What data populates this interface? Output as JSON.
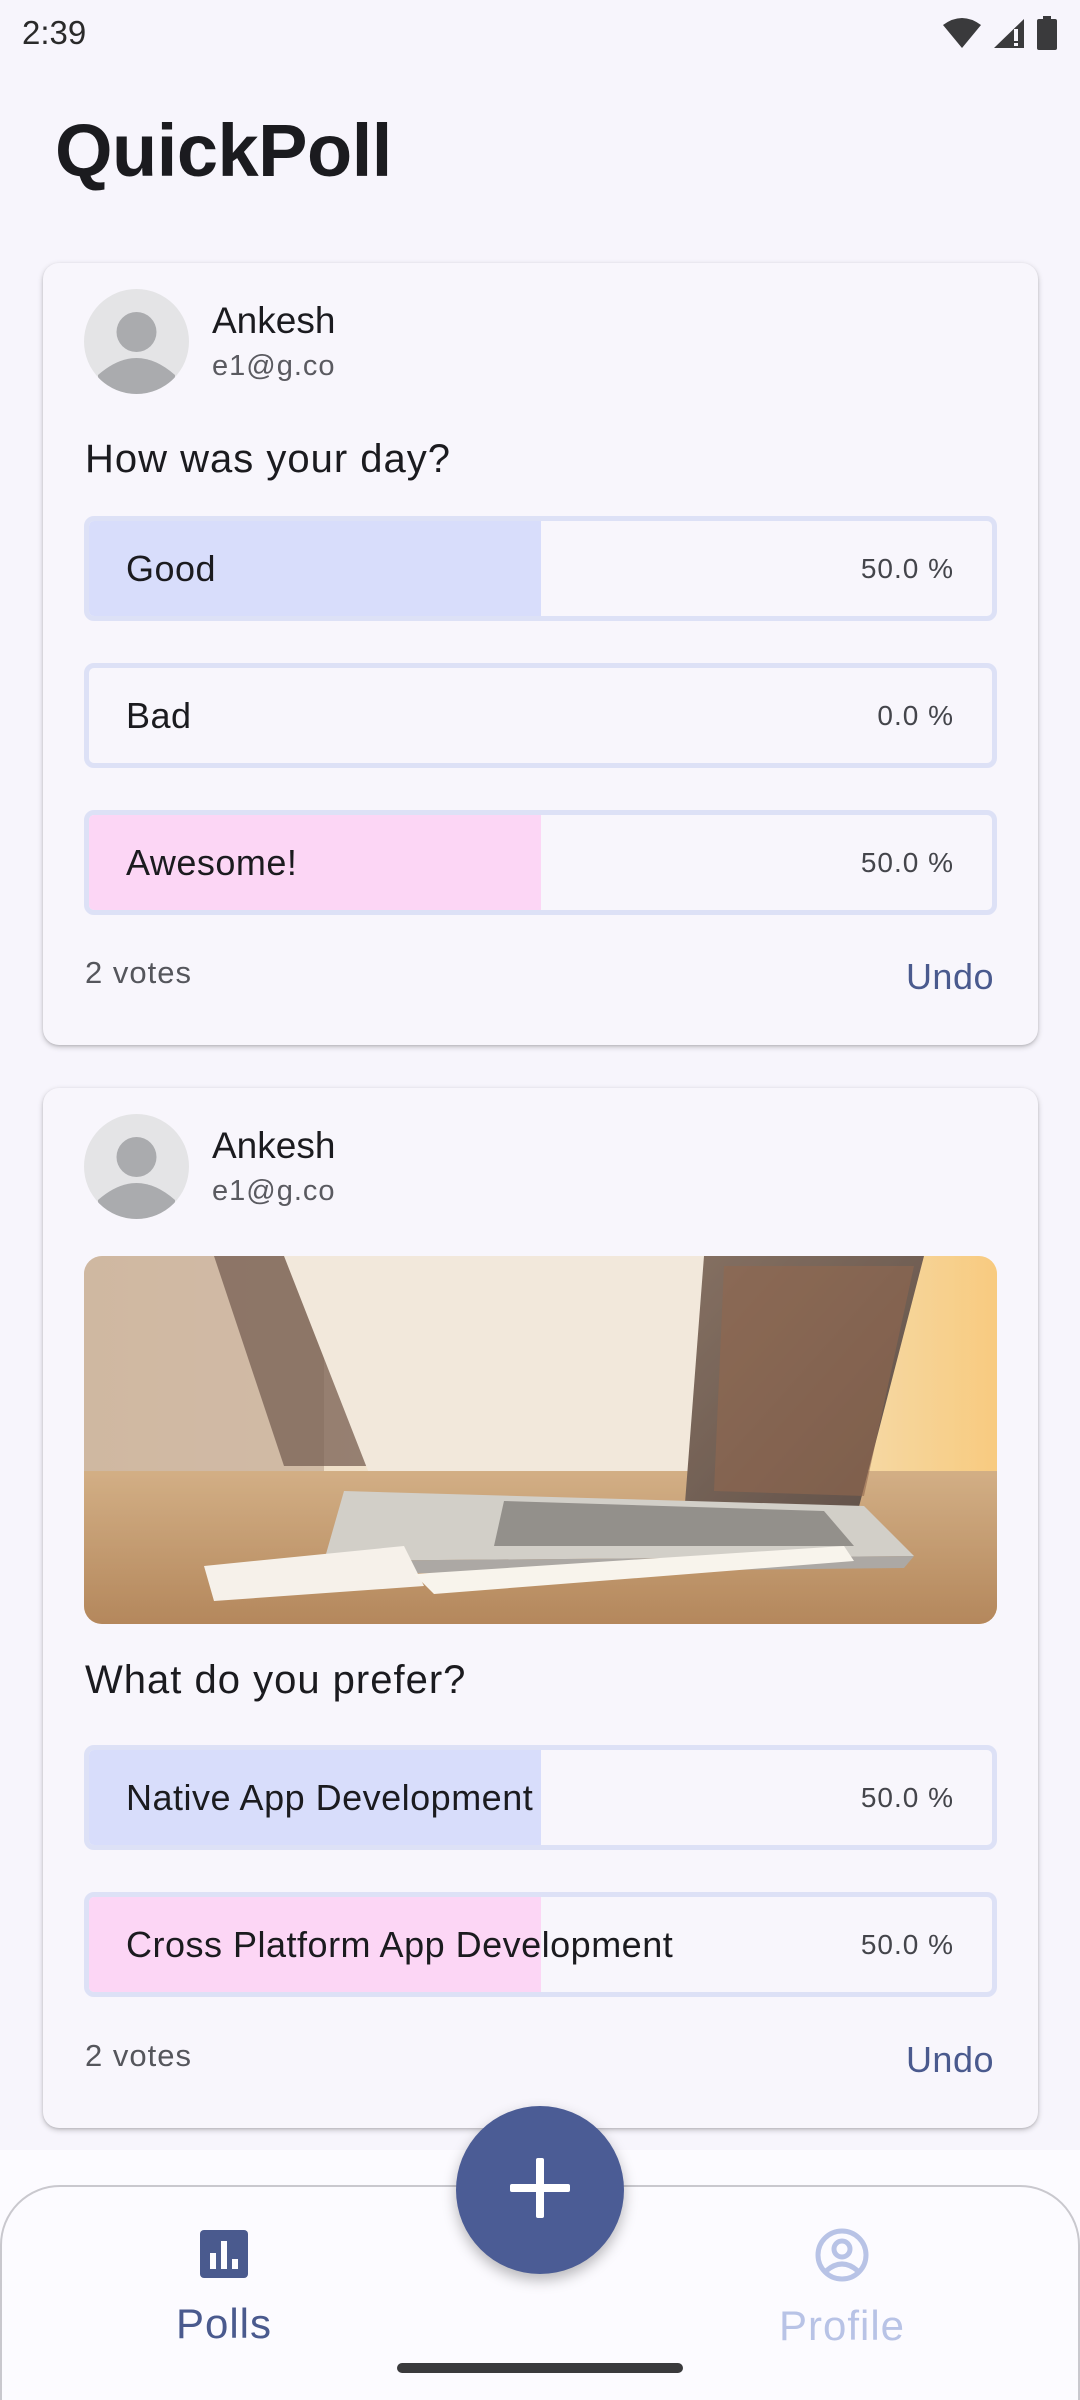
{
  "status_bar": {
    "time": "2:39",
    "icons": [
      "wifi-icon",
      "signal-icon",
      "battery-icon"
    ]
  },
  "app": {
    "title": "QuickPoll"
  },
  "polls": [
    {
      "author_name": "Ankesh",
      "author_email": "e1@g.co",
      "question": "How was your day?",
      "has_image": false,
      "options": [
        {
          "label": "Good",
          "percent_text": "50.0 %",
          "fraction": 0.5,
          "color": "#d8ddfb"
        },
        {
          "label": "Bad",
          "percent_text": "0.0 %",
          "fraction": 0.0,
          "color": "#d8ddfb"
        },
        {
          "label": "Awesome!",
          "percent_text": "50.0 %",
          "fraction": 0.5,
          "color": "#fcd6f5"
        }
      ],
      "votes": "2 votes",
      "undo_label": "Undo"
    },
    {
      "author_name": "Ankesh",
      "author_email": "e1@g.co",
      "question": "What do you prefer?",
      "has_image": true,
      "options": [
        {
          "label": "Native App Development",
          "percent_text": "50.0 %",
          "fraction": 0.5,
          "color": "#d8ddfb"
        },
        {
          "label": "Cross Platform App Development",
          "percent_text": "50.0 %",
          "fraction": 0.5,
          "color": "#fcd6f5"
        }
      ],
      "votes": "2 votes",
      "undo_label": "Undo"
    }
  ],
  "bottom_nav": {
    "items": [
      {
        "label": "Polls",
        "icon": "bar-chart-icon",
        "selected": true
      },
      {
        "label": "Profile",
        "icon": "account-circle-icon",
        "selected": false
      }
    ],
    "fab_icon": "plus-icon"
  },
  "colors": {
    "accent": "#4b5c95",
    "background": "#f7f5fc",
    "option_border": "#dde1f6",
    "fill_blue": "#d8ddfb",
    "fill_pink": "#fcd6f5",
    "inactive_nav": "#b8c3e6"
  }
}
